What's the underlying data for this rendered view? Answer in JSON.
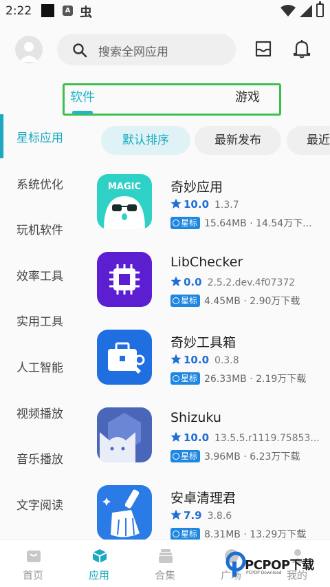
{
  "status_bar": {
    "time": "2:22",
    "icon_a": "A",
    "icon_char": "虫"
  },
  "header": {
    "search_placeholder": "搜索全网应用"
  },
  "top_tabs": [
    {
      "label": "软件",
      "active": true
    },
    {
      "label": "游戏",
      "active": false
    }
  ],
  "sidebar": {
    "items": [
      {
        "label": "星标应用",
        "active": true
      },
      {
        "label": "系统优化"
      },
      {
        "label": "玩机软件"
      },
      {
        "label": "效率工具"
      },
      {
        "label": "实用工具"
      },
      {
        "label": "人工智能"
      },
      {
        "label": "视频播放"
      },
      {
        "label": "音乐播放"
      },
      {
        "label": "文字阅读"
      }
    ]
  },
  "sort_chips": [
    {
      "label": "默认排序",
      "active": true
    },
    {
      "label": "最新发布"
    },
    {
      "label": "最近"
    }
  ],
  "apps": [
    {
      "name": "奇妙应用",
      "icon_text": "MAGIC",
      "rating": "10.0",
      "version": "1.3.7",
      "badge": "星标",
      "meta": "15.64MB · 14.54万下..."
    },
    {
      "name": "LibChecker",
      "rating": "0.0",
      "version": "2.5.2.dev.4f07372",
      "badge": "星标",
      "meta": "4.45MB · 2.90万下载"
    },
    {
      "name": "奇妙工具箱",
      "rating": "10.0",
      "version": "0.3.8",
      "badge": "星标",
      "meta": "26.33MB · 2.19万下载"
    },
    {
      "name": "Shizuku",
      "rating": "10.0",
      "version": "13.5.5.r1119.75853...",
      "badge": "星标",
      "meta": "3.96MB · 6.23万下载"
    },
    {
      "name": "安卓清理君",
      "rating": "7.9",
      "version": "3.8.6",
      "badge": "星标",
      "meta": "8.31MB · 13.29万下载"
    }
  ],
  "bottom_nav": [
    {
      "label": "首页"
    },
    {
      "label": "应用",
      "active": true
    },
    {
      "label": "合集"
    },
    {
      "label": "广场"
    },
    {
      "label": "我的"
    }
  ],
  "watermark": {
    "text": "PCPOP下载",
    "sub": "PCPOP Download"
  },
  "colors": {
    "accent": "#1aa9c0",
    "badge": "#1f87e0",
    "rating": "#1f6fd6",
    "tab_outline": "#3cbf4d"
  }
}
